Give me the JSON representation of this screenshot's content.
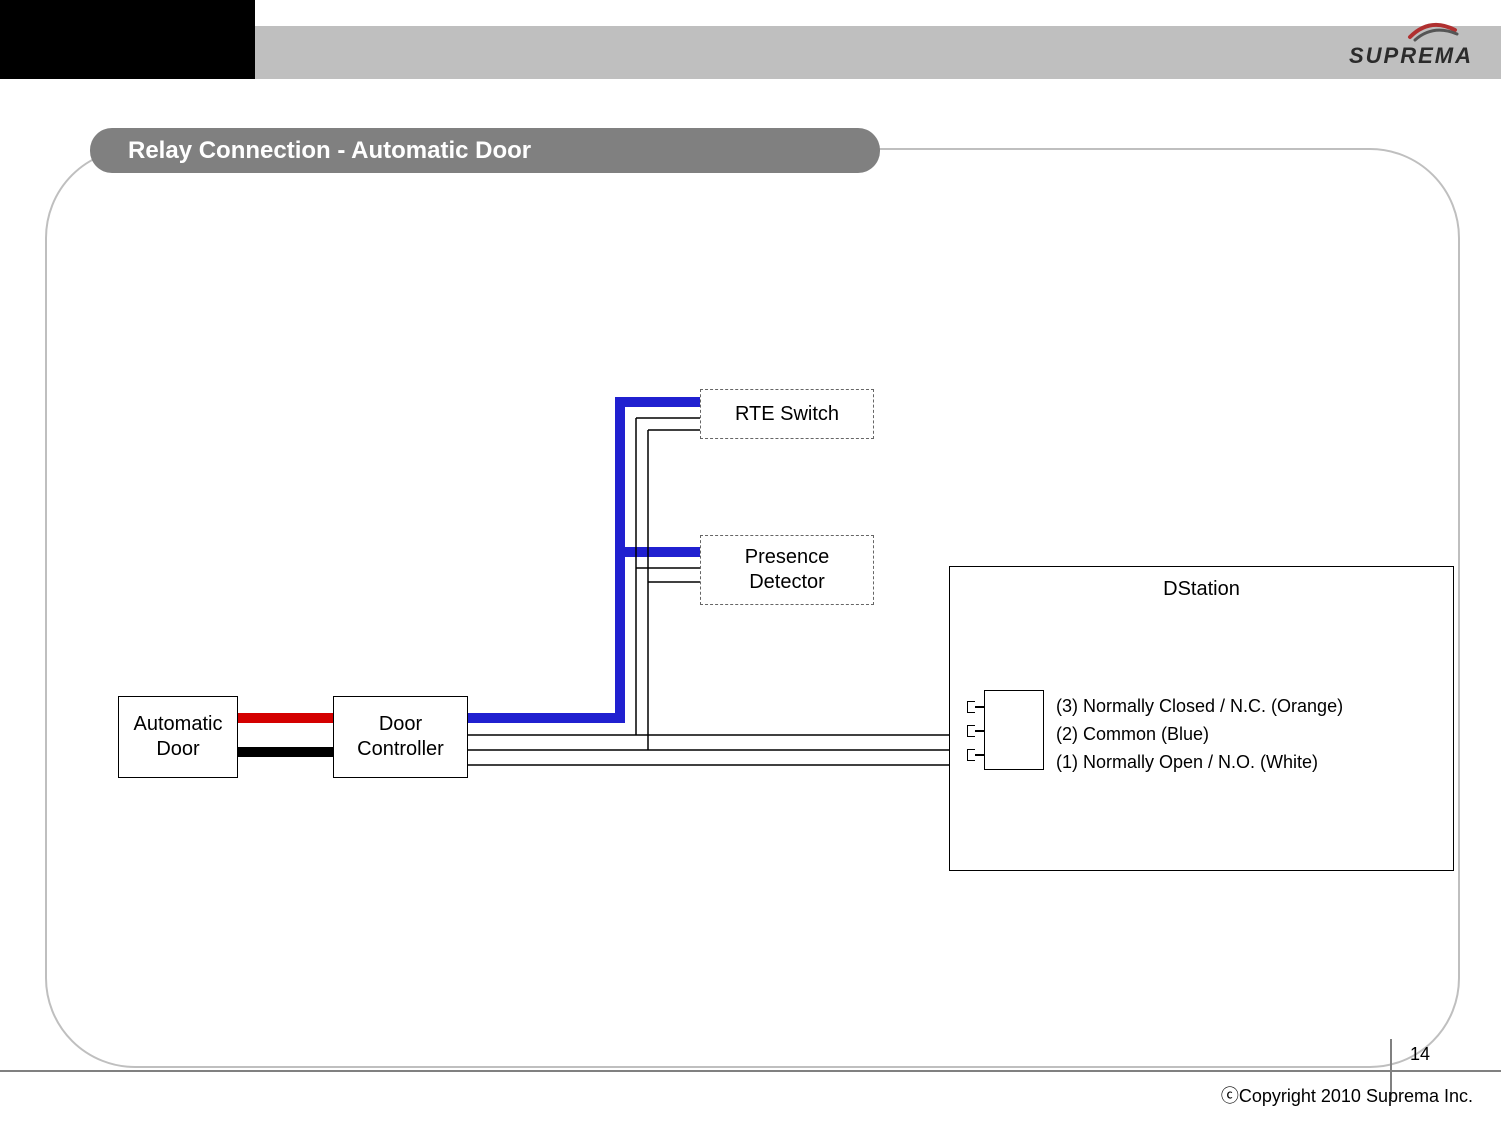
{
  "brand": {
    "name": "SUPREMA"
  },
  "title": "Relay Connection - Automatic Door",
  "boxes": {
    "automatic_door": "Automatic\nDoor",
    "door_controller": "Door\nController",
    "rte_switch": "RTE Switch",
    "presence_detector": "Presence\nDetector",
    "dstation": "DStation"
  },
  "pins": {
    "p3": "(3) Normally Closed / N.C. (Orange)",
    "p2": "(2) Common (Blue)",
    "p1": "(1) Normally Open / N.O. (White)"
  },
  "wires": {
    "red_thick": {
      "color": "#d40000",
      "desc": "Automatic Door to Door Controller (top)"
    },
    "black_thick": {
      "color": "#000000",
      "desc": "Automatic Door to Door Controller (bottom)"
    },
    "blue_thick": {
      "color": "#2020d0",
      "desc": "Door Controller bus up to RTE & Presence"
    },
    "thin_black": {
      "color": "#000000",
      "desc": "signal traces"
    }
  },
  "footer": {
    "page": "14",
    "copyright": "ⓒCopyright 2010 Suprema Inc."
  }
}
